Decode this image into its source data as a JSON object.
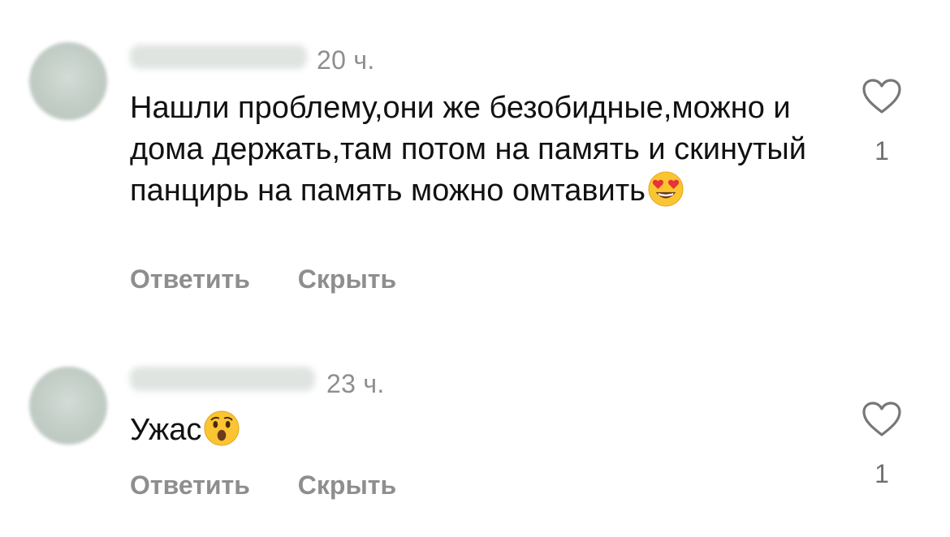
{
  "comments": [
    {
      "time": "20 ч.",
      "text": "Нашли проблему,они же безобидные,можно и дома держать,там потом на память и скинутый панцирь на память можно омтавить",
      "emoji": "smiling-face-with-heart-eyes-icon",
      "reply_label": "Ответить",
      "hide_label": "Скрыть",
      "likes": "1"
    },
    {
      "time": "23 ч.",
      "text": "Ужас",
      "emoji": "hushed-face-icon",
      "reply_label": "Ответить",
      "hide_label": "Скрыть",
      "likes": "1"
    }
  ],
  "colors": {
    "text": "#111111",
    "muted": "#8e8e8e",
    "emoji_face": "#fbc531",
    "heart_eyes": "#e8313a"
  }
}
